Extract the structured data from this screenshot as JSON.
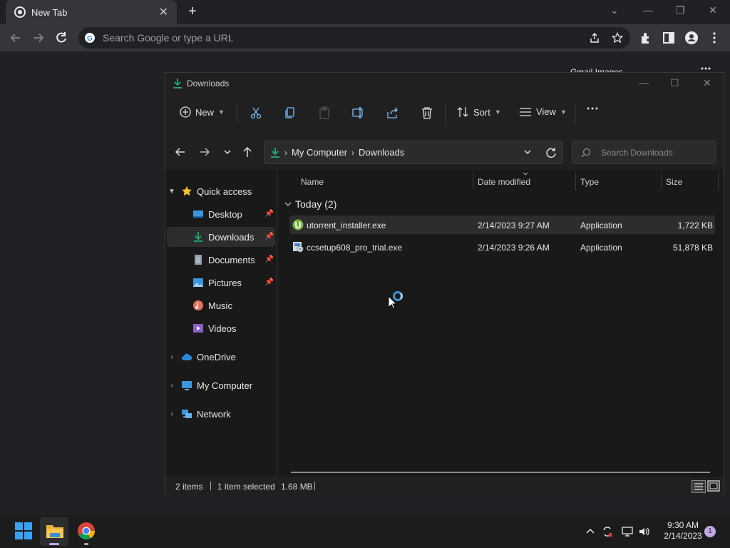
{
  "browser": {
    "tab_title": "New Tab",
    "omnibox_placeholder": "Search Google or type a URL",
    "ntp_links": "Gmail   Images"
  },
  "explorer": {
    "window_title": "Downloads",
    "cmd": {
      "new": "New",
      "sort": "Sort",
      "view": "View"
    },
    "breadcrumb": [
      "My Computer",
      "Downloads"
    ],
    "search_placeholder": "Search Downloads",
    "nav": {
      "quick_access": "Quick access",
      "desktop": "Desktop",
      "downloads": "Downloads",
      "documents": "Documents",
      "pictures": "Pictures",
      "music": "Music",
      "videos": "Videos",
      "onedrive": "OneDrive",
      "my_computer": "My Computer",
      "network": "Network"
    },
    "columns": [
      "Name",
      "Date modified",
      "Type",
      "Size"
    ],
    "group": "Today (2)",
    "files": [
      {
        "name": "utorrent_installer.exe",
        "date": "2/14/2023 9:27 AM",
        "type": "Application",
        "size": "1,722 KB"
      },
      {
        "name": "ccsetup608_pro_trial.exe",
        "date": "2/14/2023 9:26 AM",
        "type": "Application",
        "size": "51,878 KB"
      }
    ],
    "status": {
      "items": "2 items",
      "selected": "1 item selected",
      "size": "1.68 MB"
    }
  },
  "taskbar": {
    "time": "9:30 AM",
    "date": "2/14/2023",
    "notifications": "1"
  },
  "colors": {
    "accent": "#3b8fd6",
    "download_green": "#1fa36b"
  }
}
